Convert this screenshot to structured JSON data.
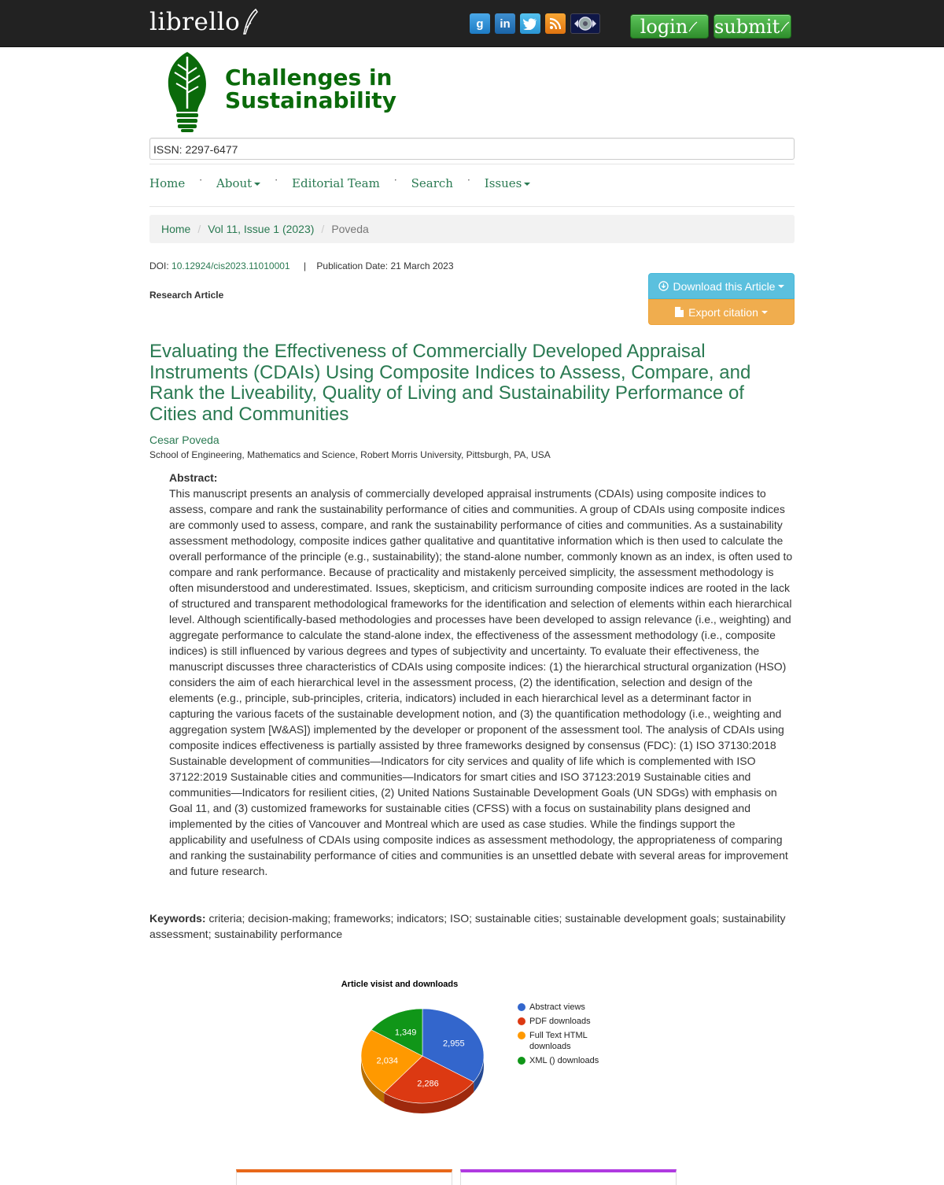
{
  "topbar": {
    "brand": "librello",
    "social": [
      {
        "icon": "google-plus-icon",
        "glyph": "g"
      },
      {
        "icon": "linkedin-icon",
        "glyph": "in"
      },
      {
        "icon": "twitter-icon",
        "glyph": "t"
      },
      {
        "icon": "rss-icon",
        "glyph": "●"
      },
      {
        "icon": "archive-icon",
        "glyph": "◎"
      }
    ],
    "login_label": "login",
    "submit_label": "submit"
  },
  "journal": {
    "title_line1": "Challenges in",
    "title_line2": "Sustainability",
    "issn": "ISSN: 2297-6477",
    "logo_color": "#0a6a0a"
  },
  "nav": {
    "items": [
      {
        "label": "Home",
        "dropdown": false
      },
      {
        "label": "About",
        "dropdown": true
      },
      {
        "label": "Editorial Team",
        "dropdown": false
      },
      {
        "label": "Search",
        "dropdown": false
      },
      {
        "label": "Issues",
        "dropdown": true
      }
    ],
    "separator": "·"
  },
  "breadcrumb": {
    "home": "Home",
    "issue": "Vol 11, Issue 1 (2023)",
    "current": "Poveda",
    "separator": "/"
  },
  "article": {
    "doi_label": "DOI:",
    "doi": "10.12924/cis2023.11010001",
    "pipe": "|",
    "pub_date": "Publication Date: 21 March 2023",
    "type": "Research Article",
    "download_label": "Download this Article",
    "export_label": "Export citation",
    "title": "Evaluating the Effectiveness of Commercially Developed Appraisal Instruments (CDAIs) Using Composite Indices to Assess, Compare, and Rank the Liveability, Quality of Living and Sustainability Performance of Cities and Communities",
    "author": "Cesar Poveda",
    "affiliation": "School of Engineering, Mathematics and Science, Robert Morris University, Pittsburgh, PA, USA",
    "abstract_label": "Abstract:",
    "abstract": "This manuscript presents an analysis of commercially developed appraisal instruments (CDAIs) using composite indices to assess, compare and rank the sustainability performance of cities and communities. A group of CDAIs using composite indices are commonly used to assess, compare, and rank the sustainability performance of cities and communities. As a sustainability assessment methodology, composite indices gather qualitative and quantitative information which is then used to calculate the overall performance of the principle (e.g., sustainability); the stand-alone number, commonly known as an index, is often used to compare and rank performance. Because of practicality and mistakenly perceived simplicity, the assessment methodology is often misunderstood and underestimated. Issues, skepticism, and criticism surrounding composite indices are rooted in the lack of structured and transparent methodological frameworks for the identification and selection of elements within each hierarchical level. Although scientifically-based methodologies and processes have been developed to assign relevance (i.e., weighting) and aggregate performance to calculate the stand-alone index, the effectiveness of the assessment methodology (i.e., composite indices) is still influenced by various degrees and types of subjectivity and uncertainty. To evaluate their effectiveness, the manuscript discusses three characteristics of CDAIs using composite indices: (1) the hierarchical structural organization (HSO) considers the aim of each hierarchical level in the assessment process, (2) the identification, selection and design of the elements (e.g., principle, sub-principles, criteria, indicators) included in each hierarchical level as a determinant factor in capturing the various facets of the sustainable development notion, and (3) the quantification methodology (i.e., weighting and aggregation system [W&AS]) implemented by the developer or proponent of the assessment tool. The analysis of CDAIs using composite indices effectiveness is partially assisted by three frameworks designed by consensus (FDC): (1) ISO 37130:2018 Sustainable development of communities—Indicators for city services and quality of life which is complemented with ISO 37122:2019 Sustainable cities and communities—Indicators for smart cities and ISO 37123:2019 Sustainable cities and communities—Indicators for resilient cities, (2) United Nations Sustainable Development Goals (UN SDGs) with emphasis on Goal 11, and (3) customized frameworks for sustainable cities (CFSS) with a focus on sustainability plans designed and implemented by the cities of Vancouver and Montreal which are used as case studies. While the findings support the applicability and usefulness of CDAIs using composite indices as assessment methodology, the appropriateness of comparing and ranking the sustainability performance of cities and communities is an unsettled debate with several areas for improvement and future research.",
    "keywords_label": "Keywords:",
    "keywords": "criteria; decision-making; frameworks; indicators; ISO; sustainable cities; sustainable development goals; sustainability assessment; sustainability performance"
  },
  "chart_data": {
    "type": "pie",
    "title": "Article visist and downloads",
    "categories": [
      "Abstract views",
      "PDF downloads",
      "Full Text HTML downloads",
      "XML () downloads"
    ],
    "values": [
      2955,
      2286,
      2034,
      1349
    ],
    "labels": [
      "2,955",
      "2,286",
      "2,034",
      "1,349"
    ],
    "colors": [
      "#3366cc",
      "#dc3912",
      "#ff9900",
      "#109618"
    ],
    "legend_position": "right"
  }
}
